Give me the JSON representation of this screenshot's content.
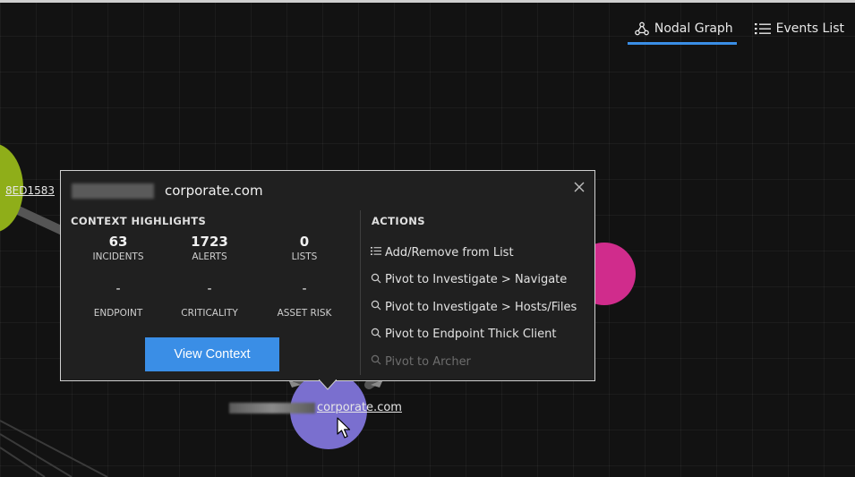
{
  "view_tabs": [
    {
      "label": "Nodal Graph",
      "icon": "nodal-graph-icon",
      "active": true
    },
    {
      "label": "Events List",
      "icon": "list-icon",
      "active": false
    }
  ],
  "graph": {
    "green_node_label": "8ED1583",
    "purple_node_label": "corporate.com",
    "colors": {
      "green": "#8fae19",
      "pink": "#d02c8c",
      "purple": "#7a6fcf"
    }
  },
  "popup": {
    "title": "corporate.com",
    "context_heading": "CONTEXT HIGHLIGHTS",
    "metrics_row1": [
      {
        "value": "63",
        "label": "INCIDENTS"
      },
      {
        "value": "1723",
        "label": "ALERTS"
      },
      {
        "value": "0",
        "label": "LISTS"
      }
    ],
    "metrics_row2": [
      {
        "value": "-",
        "label": "ENDPOINT"
      },
      {
        "value": "-",
        "label": "CRITICALITY"
      },
      {
        "value": "-",
        "label": "ASSET RISK"
      }
    ],
    "view_context_label": "View Context",
    "actions_heading": "ACTIONS",
    "actions": [
      {
        "label": "Add/Remove from List",
        "icon": "list-icon",
        "enabled": true
      },
      {
        "label": "Pivot to Investigate > Navigate",
        "icon": "search-icon",
        "enabled": true
      },
      {
        "label": "Pivot to Investigate > Hosts/Files",
        "icon": "search-icon",
        "enabled": true
      },
      {
        "label": "Pivot to Endpoint Thick Client",
        "icon": "search-icon",
        "enabled": true
      },
      {
        "label": "Pivot to Archer",
        "icon": "search-icon",
        "enabled": false
      }
    ]
  },
  "accent_color": "#3a8ee6"
}
